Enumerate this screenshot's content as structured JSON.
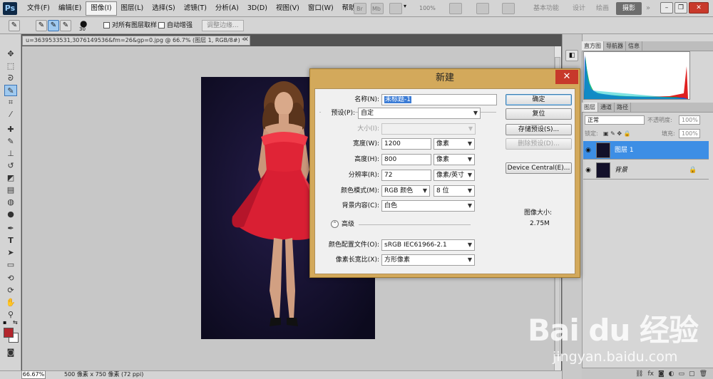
{
  "app": {
    "logo": "Ps"
  },
  "menubar": {
    "items": [
      "文件(F)",
      "编辑(E)",
      "图像(I)",
      "图层(L)",
      "选择(S)",
      "滤镜(T)",
      "分析(A)",
      "3D(D)",
      "视图(V)",
      "窗口(W)",
      "帮助(H)"
    ],
    "active_index": 2,
    "br_label": "Br",
    "mb_label": "Mb",
    "zoom_label": "100%",
    "workspaces": [
      "基本功能",
      "设计",
      "绘画"
    ],
    "active_workspace": "摄影"
  },
  "options_bar": {
    "brush_size": "30",
    "sample_all_layers": "对所有图层取样",
    "auto_enhance": "自动增强",
    "refine_edge": "调整边缘..."
  },
  "document": {
    "tab_title": "u=3639533531,3076149536&fm=26&gp=0.jpg @ 66.7% (图层 1, RGB/8#) *",
    "zoom": "66.67%",
    "doc_info": "500 像素 x 750 像素 (72 ppi)"
  },
  "panels": {
    "top_tabs": [
      "直方图",
      "导航器",
      "信息"
    ],
    "layer_tabs": [
      "图层",
      "通道",
      "路径"
    ],
    "blend_mode": "正常",
    "opacity_label": "不透明度:",
    "opacity_value": "100%",
    "lock_label": "锁定:",
    "fill_label": "填充:",
    "fill_value": "100%",
    "layers": [
      {
        "name": "图层 1",
        "selected": true
      },
      {
        "name": "背景",
        "selected": false
      }
    ],
    "histogram_colors": {
      "red": "#e02020",
      "green": "#18b018",
      "blue": "#2040e0"
    }
  },
  "dialog": {
    "title": "新建",
    "close": "✕",
    "name_label": "名称(N):",
    "name_value": "未标题-1",
    "preset_label": "预设(P):",
    "preset_value": "自定",
    "size_label": "大小(I):",
    "width_label": "宽度(W):",
    "width_value": "1200",
    "width_unit": "像素",
    "height_label": "高度(H):",
    "height_value": "800",
    "height_unit": "像素",
    "resolution_label": "分辨率(R):",
    "resolution_value": "72",
    "resolution_unit": "像素/英寸",
    "color_mode_label": "颜色模式(M):",
    "color_mode_value": "RGB 颜色",
    "bit_depth": "8 位",
    "bg_label": "背景内容(C):",
    "bg_value": "白色",
    "advanced_label": "高级",
    "profile_label": "颜色配置文件(O):",
    "profile_value": "sRGB IEC61966-2.1",
    "aspect_label": "像素长宽比(X):",
    "aspect_value": "方形像素",
    "buttons": {
      "ok": "确定",
      "reset": "复位",
      "save_preset": "存储预设(S)...",
      "delete_preset": "删除预设(D)...",
      "device_central": "Device Central(E)..."
    },
    "image_size_label": "图像大小:",
    "image_size_value": "2.75M"
  },
  "watermark": {
    "logo": "Bai du 经验",
    "url": "jingyan.baidu.com"
  }
}
